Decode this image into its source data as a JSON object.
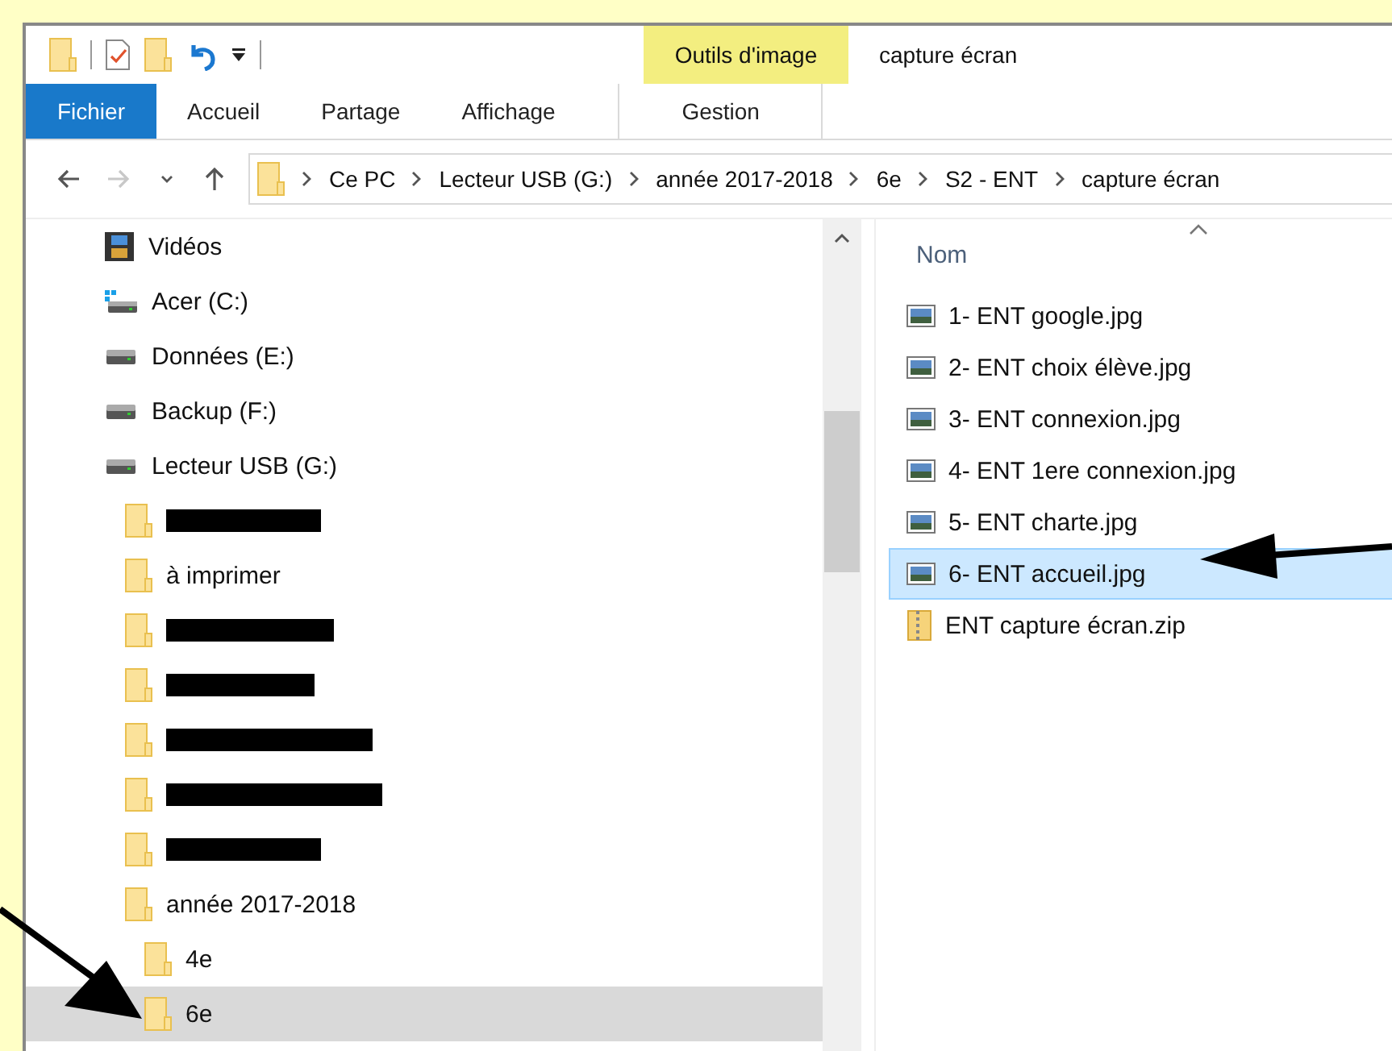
{
  "ribbon": {
    "window_title": "capture écran",
    "context_label": "Outils d'image",
    "tabs": [
      {
        "label": "Fichier",
        "kind": "file"
      },
      {
        "label": "Accueil",
        "kind": "normal"
      },
      {
        "label": "Partage",
        "kind": "normal"
      },
      {
        "label": "Affichage",
        "kind": "normal"
      },
      {
        "label": "Gestion",
        "kind": "context"
      }
    ]
  },
  "address_bar": {
    "nav_buttons": [
      {
        "kind": "back",
        "disabled": false
      },
      {
        "kind": "forward",
        "disabled": true
      },
      {
        "kind": "recent",
        "disabled": false
      },
      {
        "kind": "up",
        "disabled": false
      }
    ],
    "breadcrumbs": [
      "Ce PC",
      "Lecteur USB (G:)",
      "année 2017-2018",
      "6e",
      "S2 - ENT",
      "capture écran"
    ]
  },
  "nav_tree": [
    {
      "label": "Vidéos",
      "kind": "videos",
      "selected": false
    },
    {
      "label": "Acer (C:)",
      "kind": "system-drive",
      "selected": false
    },
    {
      "label": "Données (E:)",
      "kind": "drive",
      "selected": false
    },
    {
      "label": "Backup (F:)",
      "kind": "drive",
      "selected": false
    },
    {
      "label": "Lecteur USB (G:)",
      "kind": "drive",
      "selected": false,
      "children": [
        {
          "kind": "redacted",
          "selected": false
        },
        {
          "label": "à imprimer",
          "kind": "folder",
          "selected": false
        },
        {
          "kind": "redacted",
          "selected": false
        },
        {
          "kind": "redacted",
          "selected": false
        },
        {
          "kind": "redacted",
          "selected": false
        },
        {
          "kind": "redacted",
          "selected": false
        },
        {
          "kind": "redacted",
          "selected": false
        },
        {
          "label": "année 2017-2018",
          "kind": "folder",
          "selected": false,
          "children": [
            {
              "label": "4e",
              "kind": "folder",
              "selected": false
            },
            {
              "label": "6e",
              "kind": "folder",
              "selected": true
            }
          ]
        }
      ]
    }
  ],
  "file_list": {
    "column": "Nom",
    "files": [
      {
        "name": "1- ENT google.jpg",
        "kind": "image",
        "selected": false
      },
      {
        "name": "2- ENT choix élève.jpg",
        "kind": "image",
        "selected": false
      },
      {
        "name": "3- ENT connexion.jpg",
        "kind": "image",
        "selected": false
      },
      {
        "name": "4- ENT 1ere connexion.jpg",
        "kind": "image",
        "selected": false
      },
      {
        "name": "5- ENT charte.jpg",
        "kind": "image",
        "selected": false
      },
      {
        "name": "6- ENT accueil.jpg",
        "kind": "image",
        "selected": true
      },
      {
        "name": "ENT capture écran.zip",
        "kind": "zip",
        "selected": false
      }
    ]
  }
}
